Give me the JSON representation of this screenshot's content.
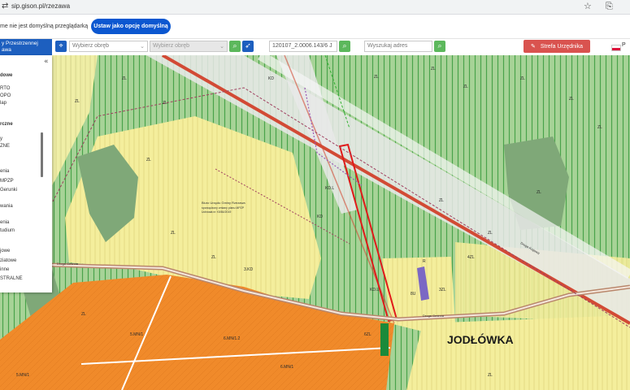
{
  "browser": {
    "url": "sip.gison.pl/rzezawa",
    "info_text": "me nie jest domyślną przeglądarką",
    "default_button": "Ustaw jako opcję domyślną"
  },
  "toolbar": {
    "app_title_line1": "y Przestrzennej",
    "app_title_line2": "awa",
    "obreb_placeholder": "Wybierz obręb",
    "obreb2_placeholder": "Wybierz obręb",
    "parcel_value": "120107_2.0006.143/6 J",
    "address_placeholder": "Wyszukaj adres",
    "urzednik_label": "Strefa Urzędnika",
    "lang_label": "P"
  },
  "panel": {
    "items": [
      {
        "label": "dowe",
        "head": true
      },
      {
        "label": "RTO",
        "head": false
      },
      {
        "label": "OPO",
        "head": false
      },
      {
        "label": "lap",
        "head": false
      },
      {
        "label": "rczne",
        "head": true
      },
      {
        "label": "y",
        "head": false
      },
      {
        "label": "ZNE",
        "head": false
      },
      {
        "label": "enia",
        "head": false
      },
      {
        "label": "MPZP",
        "head": false
      },
      {
        "label": "Gerunki",
        "head": false
      },
      {
        "label": "wania",
        "head": false
      },
      {
        "label": "enia",
        "head": false
      },
      {
        "label": "tudium",
        "head": false
      },
      {
        "label": "jowe",
        "head": false
      },
      {
        "label": "ziatowe",
        "head": false
      },
      {
        "label": "inne",
        "head": false
      },
      {
        "label": "STRALNE",
        "head": false
      }
    ]
  },
  "map": {
    "place_label": "JODŁÓWKA",
    "area_labels": [
      "ZL",
      "ZL",
      "ZL",
      "ZL",
      "ZL",
      "ZL",
      "ZL",
      "ZL",
      "ZL",
      "ZL",
      "ZL",
      "ZL",
      "KD",
      "ZL",
      "ZL",
      "ZL",
      "ZL",
      "R",
      "3ZL",
      "ZL",
      "ZL",
      "5.MN/1",
      "6.MN/1.2",
      "5.MN/1",
      "KD.L",
      "6ZL",
      "4ZL",
      "KD",
      "KD.L",
      "8U",
      "6.MN/1",
      "3.KD",
      "ZL"
    ],
    "road_labels": [
      "Droga Krajowa",
      "Droga Gminna",
      "Droga Gminna"
    ],
    "info_title": "Biuro Urzędu Gminy Rzezawa",
    "info_line1": "sporządzony zmiany planu MPZP",
    "info_line2": "Uchwała nr XII/84/2019"
  },
  "colors": {
    "accent": "#0b57d0",
    "app_blue": "#1d5fbf",
    "urzednik": "#d9534f",
    "search_green": "#5cb85c",
    "road_red": "#d24a35",
    "residential": "#f08a2a"
  }
}
